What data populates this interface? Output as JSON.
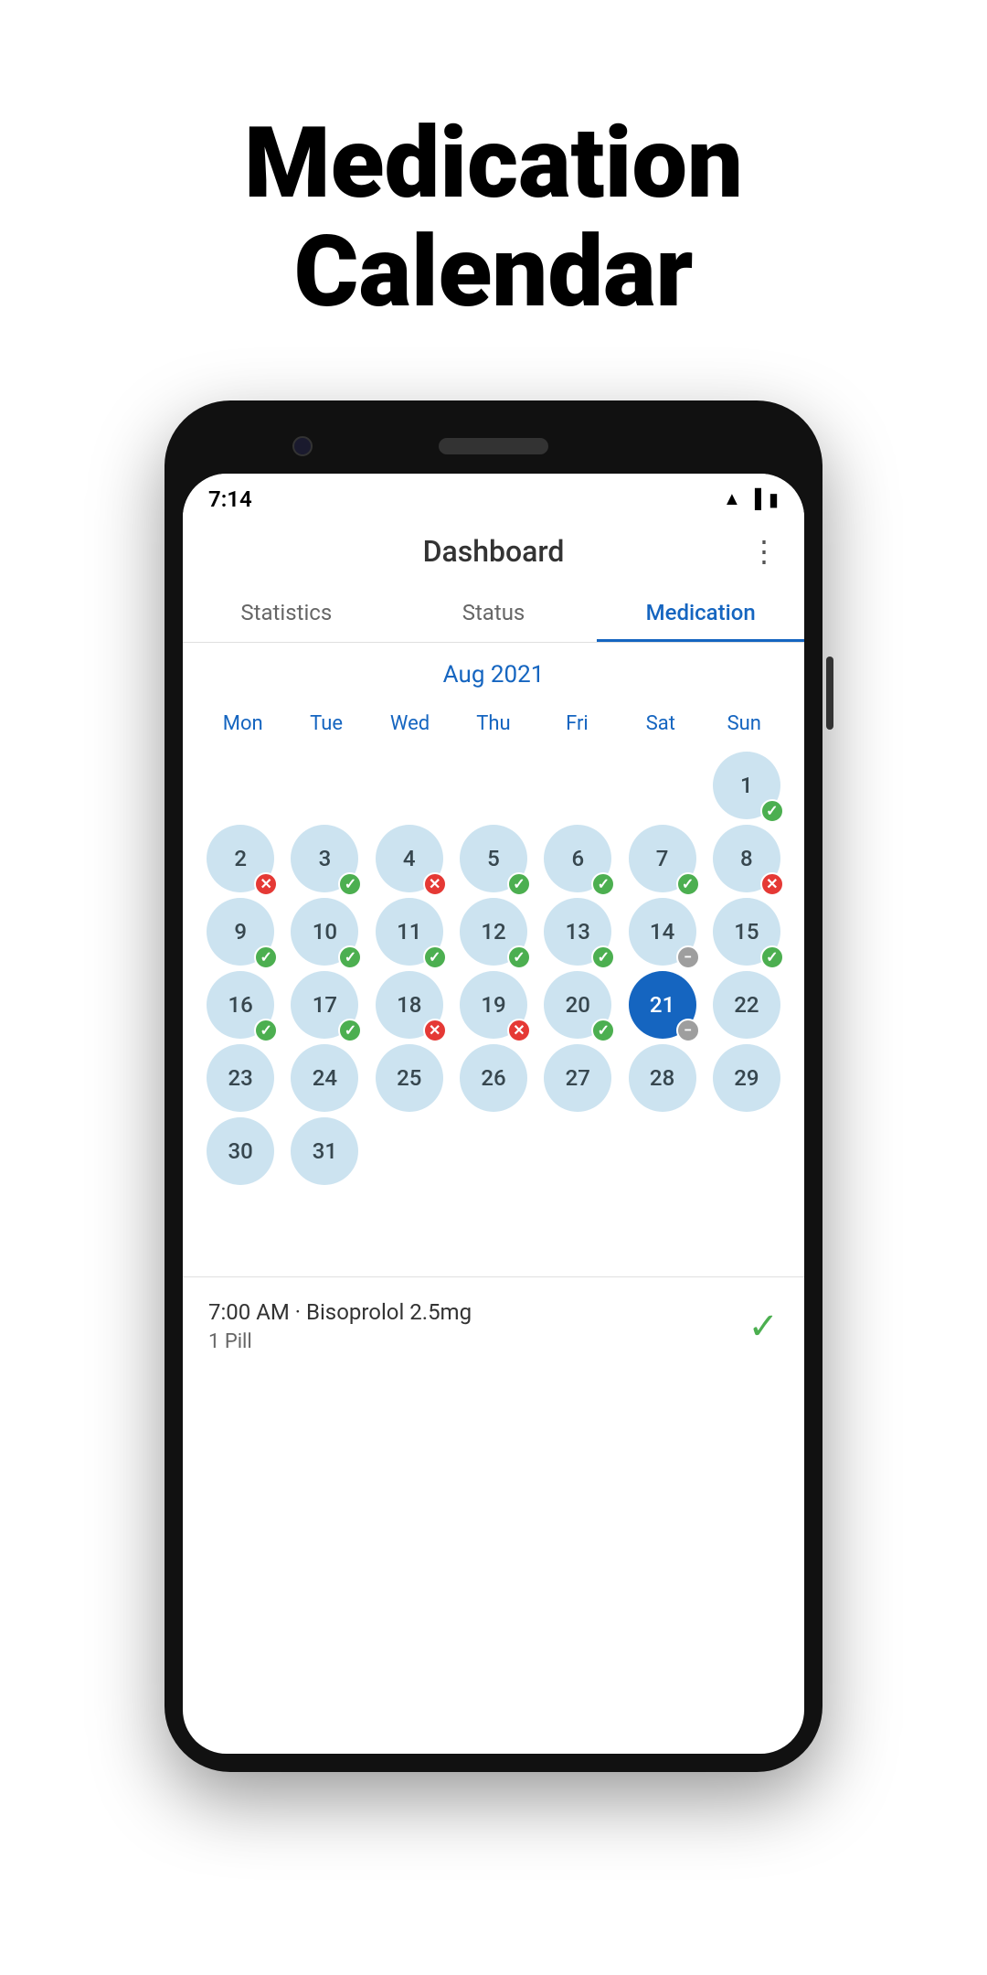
{
  "hero": {
    "title_line1": "Medication",
    "title_line2": "Calendar"
  },
  "status_bar": {
    "time": "7:14",
    "icons": [
      "wifi",
      "signal",
      "battery"
    ]
  },
  "app_header": {
    "title": "Dashboard",
    "menu_icon": "⋮"
  },
  "tabs": [
    {
      "label": "Statistics",
      "active": false
    },
    {
      "label": "Status",
      "active": false
    },
    {
      "label": "Medication",
      "active": true
    }
  ],
  "calendar": {
    "month_label": "Aug 2021",
    "weekdays": [
      "Mon",
      "Tue",
      "Wed",
      "Thu",
      "Fri",
      "Sat",
      "Sun"
    ],
    "days": [
      {
        "num": "",
        "badge": ""
      },
      {
        "num": "",
        "badge": ""
      },
      {
        "num": "",
        "badge": ""
      },
      {
        "num": "",
        "badge": ""
      },
      {
        "num": "",
        "badge": ""
      },
      {
        "num": "",
        "badge": ""
      },
      {
        "num": "1",
        "badge": "check"
      },
      {
        "num": "2",
        "badge": "cross"
      },
      {
        "num": "3",
        "badge": "check"
      },
      {
        "num": "4",
        "badge": "cross"
      },
      {
        "num": "5",
        "badge": "check"
      },
      {
        "num": "6",
        "badge": "check"
      },
      {
        "num": "7",
        "badge": "check"
      },
      {
        "num": "8",
        "badge": "cross"
      },
      {
        "num": "9",
        "badge": "check"
      },
      {
        "num": "10",
        "badge": "check"
      },
      {
        "num": "11",
        "badge": "check"
      },
      {
        "num": "12",
        "badge": "check"
      },
      {
        "num": "13",
        "badge": "check"
      },
      {
        "num": "14",
        "badge": "minus"
      },
      {
        "num": "15",
        "badge": "check"
      },
      {
        "num": "16",
        "badge": "check"
      },
      {
        "num": "17",
        "badge": "check"
      },
      {
        "num": "18",
        "badge": "cross"
      },
      {
        "num": "19",
        "badge": "cross"
      },
      {
        "num": "20",
        "badge": "check"
      },
      {
        "num": "21",
        "badge": "minus",
        "today": true
      },
      {
        "num": "22",
        "badge": ""
      },
      {
        "num": "23",
        "badge": ""
      },
      {
        "num": "24",
        "badge": ""
      },
      {
        "num": "25",
        "badge": ""
      },
      {
        "num": "26",
        "badge": ""
      },
      {
        "num": "27",
        "badge": ""
      },
      {
        "num": "28",
        "badge": ""
      },
      {
        "num": "29",
        "badge": ""
      },
      {
        "num": "30",
        "badge": ""
      },
      {
        "num": "31",
        "badge": ""
      },
      {
        "num": "",
        "badge": ""
      },
      {
        "num": "",
        "badge": ""
      },
      {
        "num": "",
        "badge": ""
      },
      {
        "num": "",
        "badge": ""
      },
      {
        "num": "",
        "badge": ""
      },
      {
        "num": "",
        "badge": ""
      }
    ]
  },
  "medication_entry": {
    "time_name": "7:00 AM · Bisoprolol 2.5mg",
    "dose": "1 Pill",
    "check_icon": "✓"
  }
}
